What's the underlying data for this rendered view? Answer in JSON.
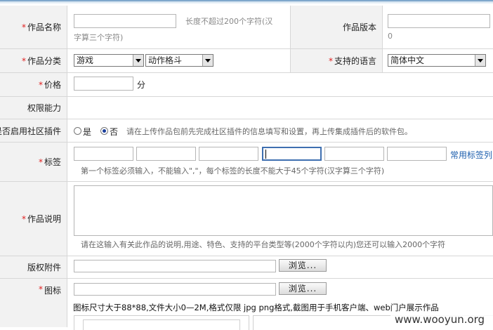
{
  "form": {
    "work_name": {
      "label": "作品名称",
      "required": "*",
      "value": "",
      "hint_line1": "长度不超过200个字符(汉",
      "hint_line2": "字算三个字符)"
    },
    "work_version": {
      "label": "作品版本",
      "value": "",
      "counter": "0"
    },
    "category": {
      "label": "作品分类",
      "required": "*",
      "primary": "游戏",
      "secondary": "动作格斗"
    },
    "language": {
      "label": "支持的语言",
      "required": "*",
      "selected": "简体中文"
    },
    "price": {
      "label": "价格",
      "required": "*",
      "value": "",
      "unit": "分"
    },
    "permissions": {
      "label": "权限能力"
    },
    "community_plugin": {
      "label": "是否启用社区插件",
      "option_yes": "是",
      "option_no": "否",
      "selected": "否",
      "hint": "请在上传作品包前先完成社区插件的信息填写和设置，再上传集成插件后的软件包。"
    },
    "tags": {
      "label": "标签",
      "required": "*",
      "values": [
        "",
        "",
        "",
        "",
        "",
        ""
      ],
      "common_tags_link": "常用标签列",
      "hint": "第一个标签必须输入，不能输入\",\"，每个标签的长度不能大于45个字符(汉字算三个字符)"
    },
    "description": {
      "label": "作品说明",
      "required": "*",
      "value": "",
      "hint": "请在这输入有关此作品的说明,用途、特色、支持的平台类型等(2000个字符以内)您还可以输入2000个字符"
    },
    "copyright_attachment": {
      "label": "版权附件",
      "value": "",
      "browse_label": "浏览..."
    },
    "icon": {
      "label": "图标",
      "required": "*",
      "value": "",
      "browse_label": "浏览...",
      "hint": "图标尺寸大于88*88,文件大小0—2M,格式仅限 jpg png格式,截图用于手机客户端、web门户展示作品"
    }
  },
  "watermark": "www.wooyun.org",
  "colors": {
    "required": "#e02020",
    "link": "#1d5fae",
    "label_bg": "#f2f2f2",
    "border": "#d7d7d7",
    "hint": "#888888"
  }
}
